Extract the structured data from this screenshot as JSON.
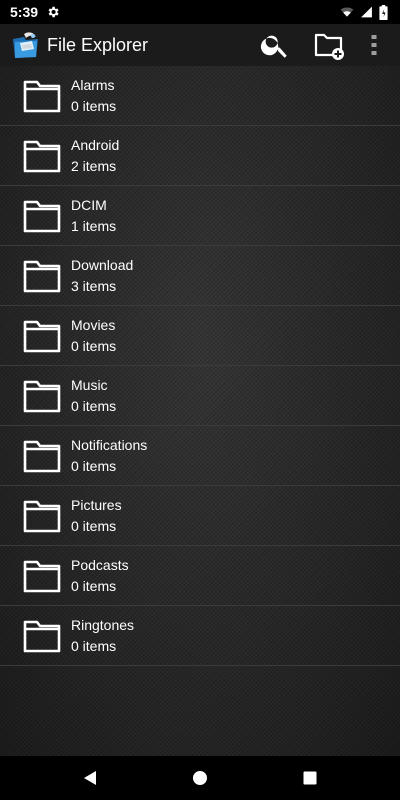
{
  "status_bar": {
    "time": "5:39",
    "icons": [
      "gear-icon",
      "wifi-icon",
      "signal-icon",
      "battery-icon"
    ]
  },
  "app_bar": {
    "title": "File Explorer",
    "logo_icon": "file-explorer-logo",
    "actions": [
      "search-icon",
      "new-folder-icon",
      "more-vert-icon"
    ]
  },
  "files": [
    {
      "name": "Alarms",
      "count": "0 items"
    },
    {
      "name": "Android",
      "count": "2 items"
    },
    {
      "name": "DCIM",
      "count": "1 items"
    },
    {
      "name": "Download",
      "count": "3 items"
    },
    {
      "name": "Movies",
      "count": "0 items"
    },
    {
      "name": "Music",
      "count": "0 items"
    },
    {
      "name": "Notifications",
      "count": "0 items"
    },
    {
      "name": "Pictures",
      "count": "0 items"
    },
    {
      "name": "Podcasts",
      "count": "0 items"
    },
    {
      "name": "Ringtones",
      "count": "0 items"
    }
  ],
  "nav_bar": {
    "buttons": [
      "back-icon",
      "home-icon",
      "recents-icon"
    ]
  },
  "colors": {
    "app_bar": "#1b1b1b",
    "list_background": "#2a2a2a",
    "divider": "#3b3b3b",
    "text": "#ffffff"
  }
}
